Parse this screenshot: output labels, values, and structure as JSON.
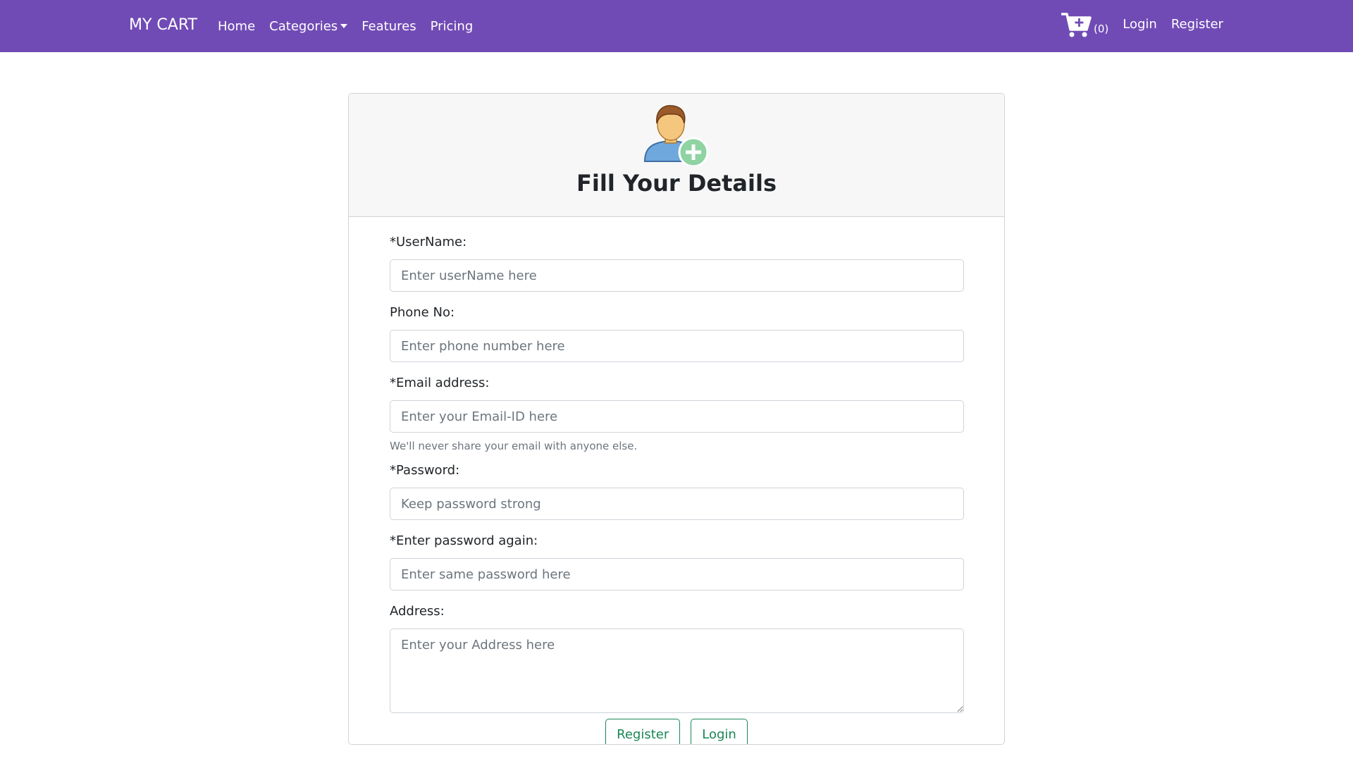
{
  "nav": {
    "brand": "MY CART",
    "links": [
      "Home",
      "Categories",
      "Features",
      "Pricing"
    ],
    "cart_count": "(0)",
    "login": "Login",
    "register": "Register",
    "bg_color": "#714bb5"
  },
  "form": {
    "title": "Fill Your Details",
    "username_label": "*UserName:",
    "username_placeholder": "Enter userName here",
    "phone_label": "Phone No:",
    "phone_placeholder": "Enter phone number here",
    "email_label": "*Email address:",
    "email_placeholder": "Enter your Email-ID here",
    "email_help": "We'll never share your email with anyone else.",
    "password_label": "*Password:",
    "password_placeholder": "Keep password strong",
    "password2_label": "*Enter password again:",
    "password2_placeholder": "Enter same password here",
    "address_label": "Address:",
    "address_placeholder": "Enter your Address here",
    "register_button": "Register",
    "login_button": "Login",
    "button_color": "#198754"
  },
  "icons": {
    "cart": "cart-plus-icon",
    "avatar": "add-user-icon"
  }
}
